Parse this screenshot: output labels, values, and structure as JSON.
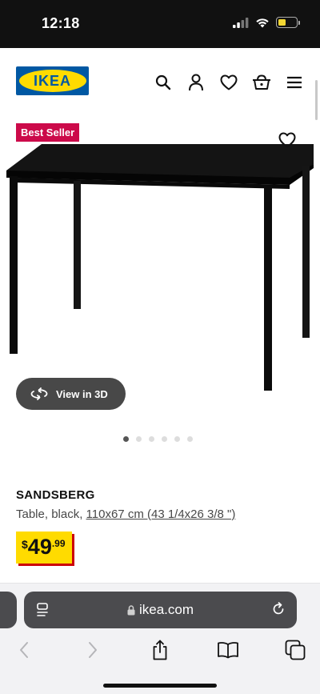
{
  "status_bar": {
    "time": "12:18"
  },
  "header": {
    "logo_text": "IKEA",
    "icons": [
      "search-icon",
      "user-icon",
      "heart-icon",
      "basket-icon",
      "menu-icon"
    ]
  },
  "product": {
    "badge": "Best Seller",
    "view_3d_label": "View in 3D",
    "image_count": 6,
    "active_image": 1,
    "name": "SANDSBERG",
    "description": "Table, black, ",
    "dimensions": "110x67 cm (43 1/4x26 3/8 \")",
    "price": {
      "currency": "$",
      "integer": "49",
      "decimals": ".99"
    }
  },
  "browser": {
    "url": "ikea.com"
  },
  "colors": {
    "ikea_blue": "#0058a3",
    "ikea_yellow": "#ffdb00",
    "badge_red": "#cc0a4a",
    "price_shadow_red": "#cc0008"
  }
}
